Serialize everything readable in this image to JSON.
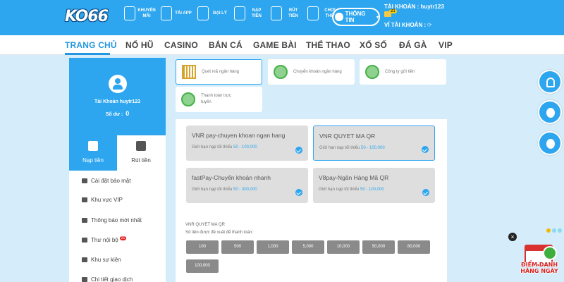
{
  "header": {
    "logo": "KO66",
    "menu": [
      {
        "label": "KHUYẾN MÃI",
        "icon": "gift-icon"
      },
      {
        "label": "TẢI APP",
        "icon": "phone-icon"
      },
      {
        "label": "ĐẠI LÝ",
        "icon": "agent-icon"
      },
      {
        "label": "NẠP TIỀN",
        "icon": "deposit-icon"
      },
      {
        "label": "RÚT TIỀN",
        "icon": "withdraw-icon"
      },
      {
        "label": "CHƠI THỬ",
        "icon": "gamepad-icon"
      }
    ],
    "user_button": "THÔNG TIN",
    "account_label": "TÀI KHOẢN : huytr123",
    "mail_badge": "21",
    "wallet_label": "VÍ TÀI KHOẢN :"
  },
  "nav": {
    "items": [
      "TRANG CHỦ",
      "NỔ HŨ",
      "CASINO",
      "BẮN CÁ",
      "GAME BÀI",
      "THỂ THAO",
      "XỔ SỐ",
      "ĐÁ GÀ",
      "VIP"
    ],
    "active": "TRANG CHỦ"
  },
  "sidebar": {
    "account_name": "Tài Khoản huytr123",
    "balance_label": "Số dư :",
    "balance_value": "0",
    "tabs": [
      {
        "label": "Nạp tiền",
        "active": true
      },
      {
        "label": "Rút tiền",
        "active": false
      }
    ],
    "menu": [
      {
        "label": "Cài đặt bảo mật"
      },
      {
        "label": "Khu vực VIP"
      },
      {
        "label": "Thông báo mới nhất"
      },
      {
        "label": "Thư nội bộ",
        "badge": "21"
      },
      {
        "label": "Khu sự kiện"
      },
      {
        "label": "Chi tiết giao dịch"
      }
    ]
  },
  "methods": [
    {
      "label": "Quét mã ngân hàng",
      "icon": "qr-icon",
      "selected": true
    },
    {
      "label": "Chuyển khoản ngân hàng",
      "icon": "globe-icon",
      "selected": false
    },
    {
      "label": "Công ty gửi tiền",
      "icon": "globe-icon",
      "selected": false
    },
    {
      "label": "Thanh toán trực tuyến",
      "icon": "globe-icon",
      "selected": false
    }
  ],
  "options": [
    {
      "title": "VNR pay-chuyen khoan ngan hang",
      "limit_prefix": "Giới hạn nạp tối thiểu",
      "limit": "50 - 100,000",
      "selected": false
    },
    {
      "title": "VNR QUYET MA QR",
      "limit_prefix": "Giới hạn nạp tối thiểu",
      "limit": "50 - 100,000",
      "selected": true
    },
    {
      "title": "fastPay-Chuyển khoản nhanh",
      "limit_prefix": "Giới hạn nạp tối thiểu",
      "limit": "50 - 300,000",
      "selected": false
    },
    {
      "title": "V8pay-Ngân Hàng Mã QR",
      "limit_prefix": "Giới hạn nạp tối thiểu",
      "limit": "50 - 100,000",
      "selected": false
    }
  ],
  "amount_section": {
    "title": "VNR QUYET MA QR",
    "subtitle": "Số tiền được đề xuất để thanh toán:",
    "amounts": [
      "100",
      "500",
      "1,000",
      "5,000",
      "10,000",
      "50,000",
      "80,000",
      "100,000"
    ]
  },
  "floating": {
    "buttons": [
      "headset-icon",
      "facebook-icon",
      "telegram-icon"
    ],
    "close": "×",
    "daily_text_1": "ĐIỂM DANH",
    "daily_text_2": "HẰNG NGÀY"
  },
  "colors": {
    "brand": "#2ea6ef",
    "background": "#d5ecfa",
    "option_bg": "#dedede",
    "amount_bg": "#8a8a8a",
    "badge": "#e32424"
  }
}
